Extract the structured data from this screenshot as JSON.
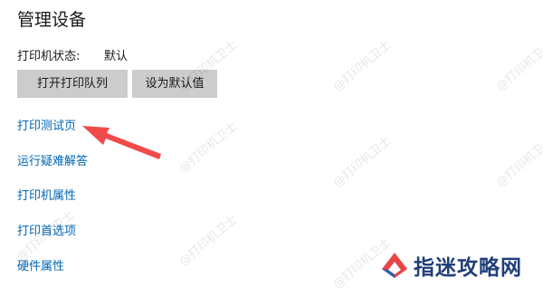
{
  "page": {
    "title": "管理设备"
  },
  "status": {
    "label": "打印机状态:",
    "value": "默认"
  },
  "buttons": {
    "open_queue": "打开打印队列",
    "set_default": "设为默认值"
  },
  "links": [
    "打印测试页",
    "运行疑难解答",
    "打印机属性",
    "打印首选项",
    "硬件属性"
  ],
  "watermark": {
    "text": "@打印机卫士"
  },
  "brand": {
    "text": "指迷攻略网"
  },
  "colors": {
    "link": "#0066b4",
    "button_bg": "#cccccc",
    "arrow": "#f04a4a",
    "brand_text": "#1f3f7a"
  }
}
